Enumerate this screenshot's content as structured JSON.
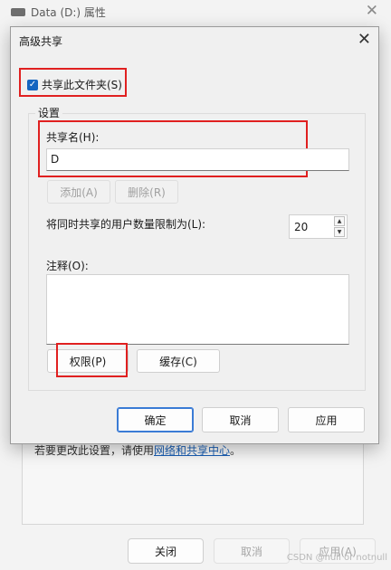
{
  "background_window": {
    "title": "Data (D:) 属性",
    "close_glyph": "✕",
    "hint_text": "若要更改此设置，请使用",
    "hint_link": "网络和共享中心",
    "hint_suffix": "。",
    "buttons": {
      "close": "关闭",
      "cancel": "取消",
      "apply": "应用(A)"
    },
    "watermark": "CSDN @null or notnull"
  },
  "dialog": {
    "title": "高级共享",
    "close_glyph": "✕",
    "share_checkbox": {
      "label": "共享此文件夹(S)",
      "checked": true,
      "check_glyph": "✓"
    },
    "settings_group_label": "设置",
    "share_name": {
      "label": "共享名(H):",
      "value": "D"
    },
    "add_button": "添加(A)",
    "remove_button": "删除(R)",
    "user_limit": {
      "label": "将同时共享的用户数量限制为(L):",
      "value": "20",
      "up_glyph": "▲",
      "down_glyph": "▼"
    },
    "comment": {
      "label": "注释(O):",
      "value": ""
    },
    "permissions_button": "权限(P)",
    "caching_button": "缓存(C)",
    "ok_button": "确定",
    "cancel_button": "取消",
    "apply_button": "应用"
  },
  "colors": {
    "highlight": "#e02020",
    "accent": "#1565c0",
    "link": "#1a5fb4"
  }
}
